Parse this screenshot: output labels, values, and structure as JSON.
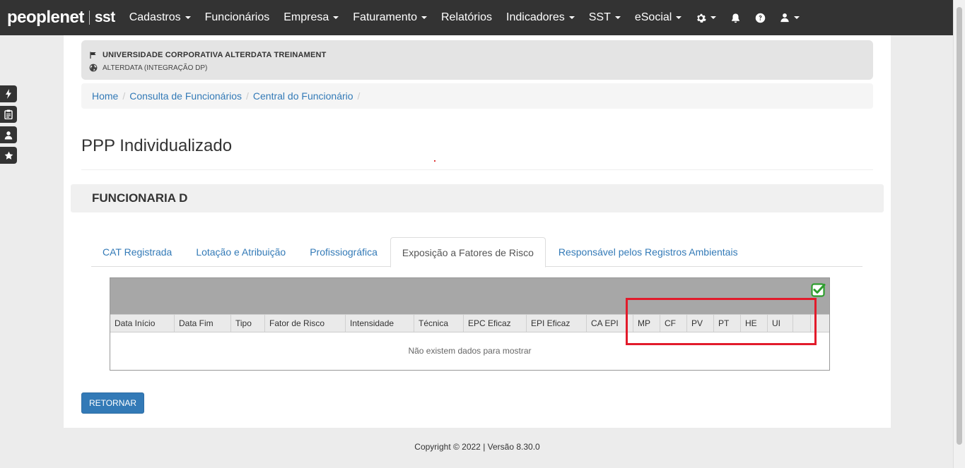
{
  "brand": {
    "name": "peoplenet",
    "product": "sst"
  },
  "nav": {
    "items": [
      {
        "label": "Cadastros",
        "dropdown": true
      },
      {
        "label": "Funcionários",
        "dropdown": false
      },
      {
        "label": "Empresa",
        "dropdown": true
      },
      {
        "label": "Faturamento",
        "dropdown": true
      },
      {
        "label": "Relatórios",
        "dropdown": false
      },
      {
        "label": "Indicadores",
        "dropdown": true
      },
      {
        "label": "SST",
        "dropdown": true
      },
      {
        "label": "eSocial",
        "dropdown": true
      }
    ],
    "icons": [
      "gear-icon",
      "bell-icon",
      "question-icon",
      "user-icon"
    ]
  },
  "side_tools": [
    "bolt-icon",
    "clipboard-icon",
    "user-icon",
    "star-icon"
  ],
  "company": {
    "name": "UNIVERSIDADE CORPORATIVA ALTERDATA TREINAMENT",
    "integration": "ALTERDATA (INTEGRAÇÃO DP)"
  },
  "breadcrumb": [
    "Home",
    "Consulta de Funcionários",
    "Central do Funcionário"
  ],
  "page_title": "PPP Individualizado",
  "employee": "FUNCIONARIA D",
  "tabs": [
    {
      "label": "CAT Registrada",
      "active": false
    },
    {
      "label": "Lotação e Atribuição",
      "active": false
    },
    {
      "label": "Profissiográfica",
      "active": false
    },
    {
      "label": "Exposição a Fatores de Risco",
      "active": true
    },
    {
      "label": "Responsável pelos Registros Ambientais",
      "active": false
    }
  ],
  "grid": {
    "columns": [
      "Data Início",
      "Data Fim",
      "Tipo",
      "Fator de Risco",
      "Intensidade",
      "Técnica",
      "EPC Eficaz",
      "EPI Eficaz",
      "CA EPI",
      "MP",
      "CF",
      "PV",
      "PT",
      "HE",
      "UI",
      ""
    ],
    "empty_message": "Não existem dados para mostrar"
  },
  "buttons": {
    "return": "RETORNAR"
  },
  "footer": "Copyright © 2022 | Versão 8.30.0",
  "colors": {
    "navbar": "#333333",
    "link": "#337ab7",
    "highlight": "#e21b2b",
    "check": "#2e9e2e"
  }
}
